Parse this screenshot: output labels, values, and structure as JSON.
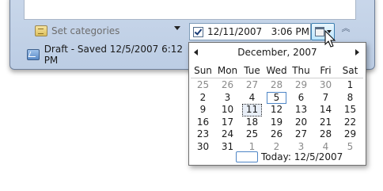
{
  "categories": {
    "placeholder": "Set categories",
    "icon": "category-icon"
  },
  "date_picker": {
    "checked": true,
    "value": "12/11/2007   3:06 PM",
    "button_icon": "calendar-icon"
  },
  "collapse": {
    "icon": "double-chevron-up-icon",
    "glyph": "︽"
  },
  "status": {
    "text": "Draft - Saved 12/5/2007 6:12 PM",
    "icon": "draft-icon"
  },
  "calendar": {
    "month_title": "December, 2007",
    "weekdays": [
      "Sun",
      "Mon",
      "Tue",
      "Wed",
      "Thu",
      "Fri",
      "Sat"
    ],
    "days": [
      {
        "d": "25",
        "other": true
      },
      {
        "d": "26",
        "other": true
      },
      {
        "d": "27",
        "other": true
      },
      {
        "d": "28",
        "other": true
      },
      {
        "d": "29",
        "other": true
      },
      {
        "d": "30",
        "other": true
      },
      {
        "d": "1"
      },
      {
        "d": "2"
      },
      {
        "d": "3"
      },
      {
        "d": "4"
      },
      {
        "d": "5",
        "today": true
      },
      {
        "d": "6"
      },
      {
        "d": "7"
      },
      {
        "d": "8"
      },
      {
        "d": "9"
      },
      {
        "d": "10"
      },
      {
        "d": "11",
        "selected": true
      },
      {
        "d": "12"
      },
      {
        "d": "13"
      },
      {
        "d": "14"
      },
      {
        "d": "15"
      },
      {
        "d": "16"
      },
      {
        "d": "17"
      },
      {
        "d": "18"
      },
      {
        "d": "19"
      },
      {
        "d": "20"
      },
      {
        "d": "21"
      },
      {
        "d": "22"
      },
      {
        "d": "23"
      },
      {
        "d": "24"
      },
      {
        "d": "25"
      },
      {
        "d": "26"
      },
      {
        "d": "27"
      },
      {
        "d": "28"
      },
      {
        "d": "29"
      },
      {
        "d": "30"
      },
      {
        "d": "31"
      },
      {
        "d": "1",
        "other": true
      },
      {
        "d": "2",
        "other": true
      },
      {
        "d": "3",
        "other": true
      },
      {
        "d": "4",
        "other": true
      },
      {
        "d": "5",
        "other": true
      }
    ],
    "today_label": "Today: 12/5/2007"
  },
  "colors": {
    "accent": "#4f86c6",
    "frame": "#bccde4",
    "muted": "#8a8a8a"
  }
}
